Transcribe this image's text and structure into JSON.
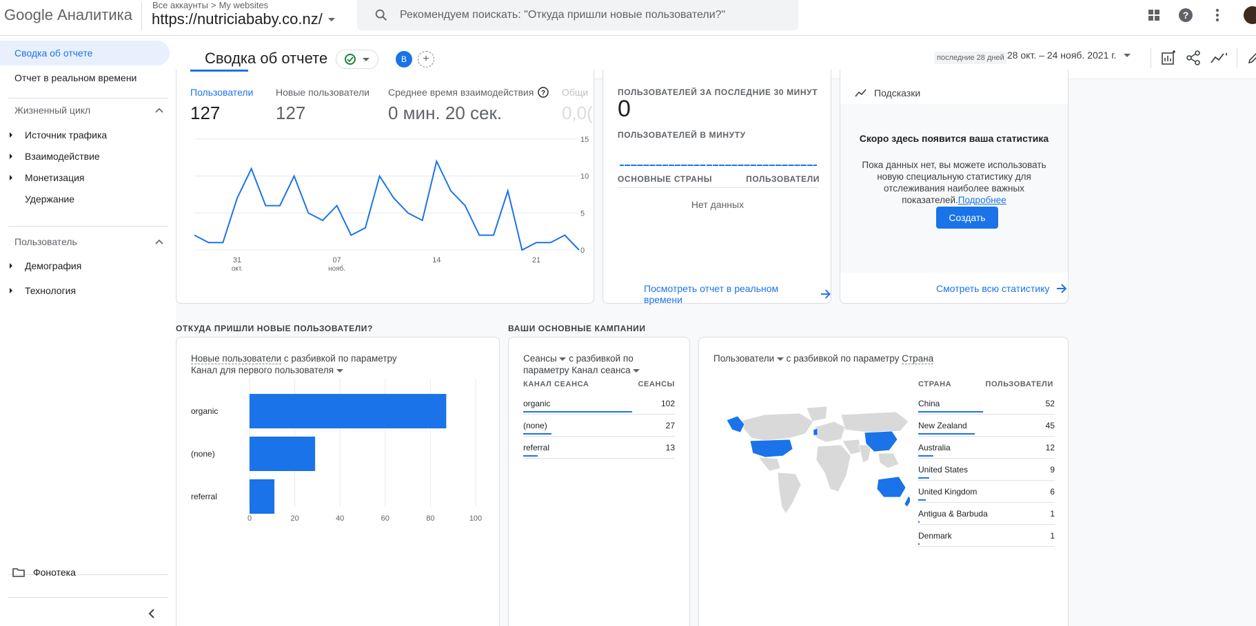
{
  "app": {
    "logo": "Google Аналитика",
    "crumb_accounts": "Все аккаунты",
    "crumb_sep": ">",
    "crumb_site": "My websites",
    "property": "https://nutriciababy.co.nz/",
    "search_placeholder": "Рекомендуем поискать: \"Откуда пришли новые пользователи?\""
  },
  "sidebar": {
    "summary": "Сводка об отчете",
    "realtime": "Отчет в реальном времени",
    "lifecycle": "Жизненный цикл",
    "lifecycle_items": [
      "Источник трафика",
      "Взаимодействие",
      "Монетизация",
      "Удержание"
    ],
    "user": "Пользователь",
    "user_items": [
      "Демография",
      "Технология"
    ],
    "library": "Фонотека"
  },
  "header": {
    "title": "Сводка об отчете",
    "badge": "B",
    "add": "+",
    "date_label": "последние 28 дней",
    "date_range": "28 окт. – 24 нояб. 2021 г."
  },
  "metrics": {
    "users_label": "Пользователи",
    "users_value": "127",
    "new_users_label": "Новые пользователи",
    "new_users_value": "127",
    "engagement_label": "Среднее время взаимодействия",
    "engagement_value": "0 мин. 20 сек.",
    "total_label": "Общи",
    "total_value": "0,0("
  },
  "chart_data": [
    {
      "type": "line",
      "title": "",
      "x_labels": [
        "31\nокт.",
        "07\nнояб.",
        "14",
        "21"
      ],
      "y_ticks": [
        0,
        5,
        10,
        15
      ],
      "ylim": [
        0,
        15
      ],
      "series": [
        {
          "values": [
            2,
            1,
            1,
            7,
            11,
            6,
            6,
            10,
            5,
            4,
            6,
            2,
            3,
            10,
            7,
            5,
            4,
            12,
            8,
            6,
            2,
            2,
            8,
            0,
            1,
            1,
            2,
            0
          ]
        }
      ]
    },
    {
      "type": "bar",
      "title": "Новые пользователи с разбивкой по параметру Канал для первого пользователя",
      "categories": [
        "organic",
        "(none)",
        "referral"
      ],
      "values": [
        87,
        29,
        11
      ],
      "x_ticks": [
        0,
        20,
        40,
        60,
        80,
        100
      ],
      "xlim": [
        0,
        100
      ]
    }
  ],
  "realtime": {
    "label_30": "ПОЛЬЗОВАТЕЛЕЙ ЗА ПОСЛЕДНИЕ 30 МИНУТ",
    "value": "0",
    "label_min": "ПОЛЬЗОВАТЕЛЕЙ В МИНУТУ",
    "col_country": "ОСНОВНЫЕ СТРАНЫ",
    "col_users": "ПОЛЬЗОВАТЕЛИ",
    "no_data": "Нет данных",
    "link": "Посмотреть отчет в реальном времени"
  },
  "insights": {
    "title": "Подсказки",
    "heading": "Скоро здесь появится ваша статистика",
    "body": "Пока данных нет, вы можете использовать новую специальную статистику для отслеживания наиболее важных показателей.",
    "more": "Подробнее",
    "create": "Создать",
    "link": "Смотреть всю статистику"
  },
  "sections": {
    "new_users": "ОТКУДА ПРИШЛИ НОВЫЕ ПОЛЬЗОВАТЕЛИ?",
    "campaigns": "ВАШИ ОСНОВНЫЕ КАМПАНИИ"
  },
  "bar_card": {
    "title_metric": "Новые пользователи",
    "title_mid": "с разбивкой по параметру",
    "title_dim": "Канал для первого пользователя"
  },
  "campaigns": {
    "title_metric": "Сеансы",
    "title_mid": "с разбивкой по",
    "title_dim_pre": "параметру",
    "title_dim": "Канал сеанса",
    "col1": "КАНАЛ СЕАНСА",
    "col2": "СЕАНСЫ",
    "rows": [
      {
        "name": "organic",
        "value": "102",
        "share": 1.0
      },
      {
        "name": "(none)",
        "value": "27",
        "share": 0.26
      },
      {
        "name": "referral",
        "value": "13",
        "share": 0.13
      }
    ]
  },
  "countries": {
    "title_metric": "Пользователи",
    "title_mid": "с разбивкой по параметру",
    "title_dim": "Страна",
    "col1": "СТРАНА",
    "col2": "ПОЛЬЗОВАТЕЛИ",
    "rows": [
      {
        "name": "China",
        "value": "52",
        "share": 1.0
      },
      {
        "name": "New Zealand",
        "value": "45",
        "share": 0.87
      },
      {
        "name": "Australia",
        "value": "12",
        "share": 0.23
      },
      {
        "name": "United States",
        "value": "9",
        "share": 0.17
      },
      {
        "name": "United Kingdom",
        "value": "6",
        "share": 0.12
      },
      {
        "name": "Antigua & Barbuda",
        "value": "1",
        "share": 0.02
      },
      {
        "name": "Denmark",
        "value": "1",
        "share": 0.02
      }
    ]
  },
  "colors": {
    "accent": "#1a73e8",
    "map_highlight": "#1a73e8",
    "map_base": "#d9d9d9"
  }
}
